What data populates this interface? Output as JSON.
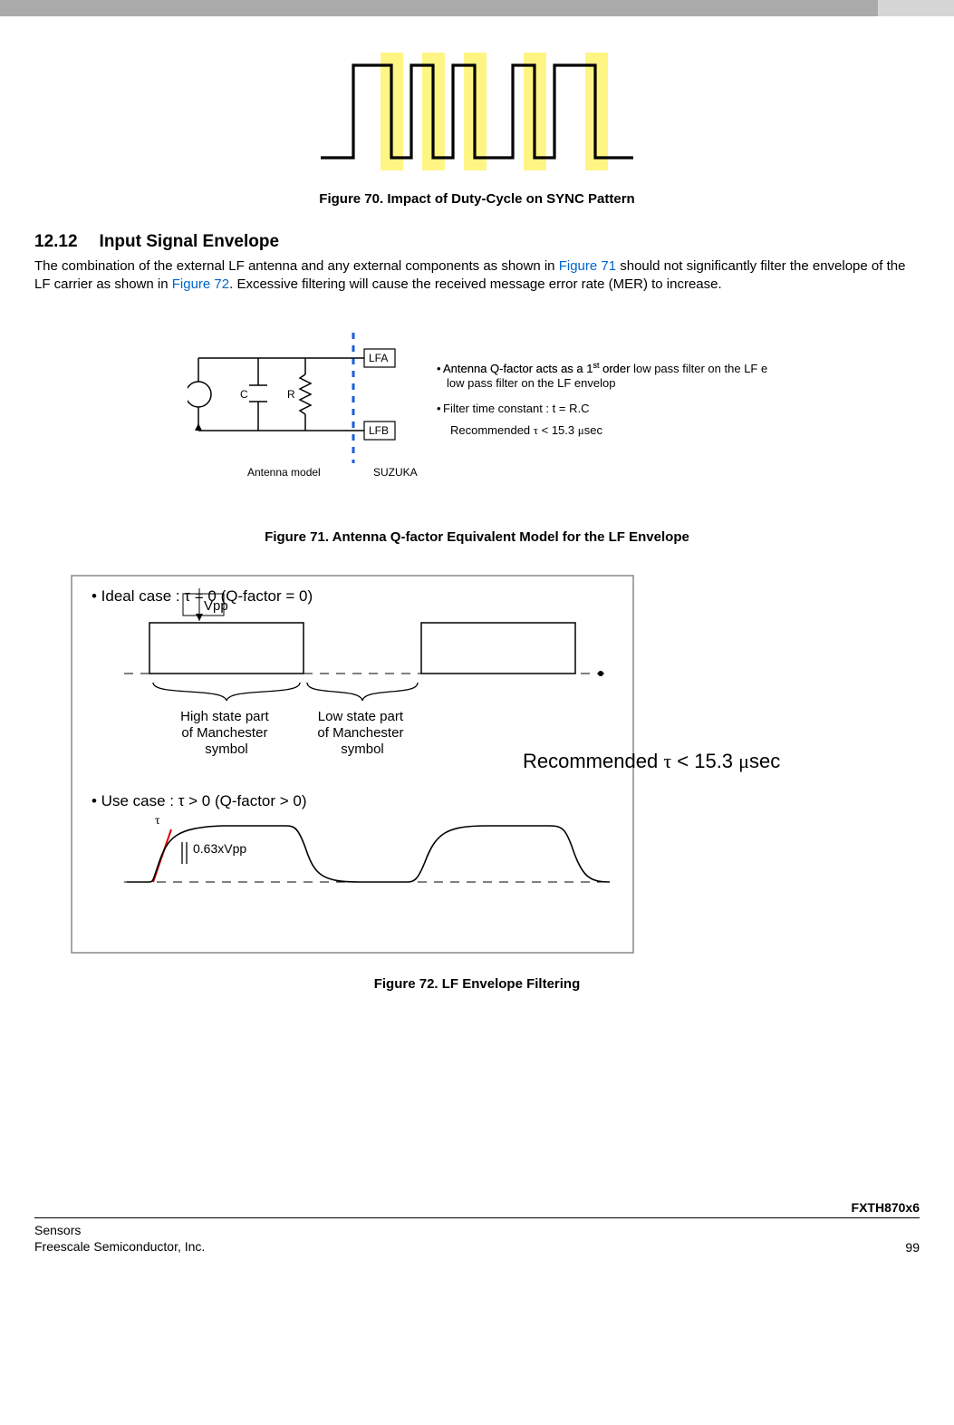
{
  "figure70": {
    "caption": "Figure 70. Impact of Duty-Cycle on SYNC Pattern"
  },
  "section": {
    "number": "12.12",
    "title": "Input Signal Envelope",
    "body_pre": "The combination of the external LF antenna and any external components as shown in ",
    "link1": "Figure 71",
    "body_mid1": " should not significantly filter the envelope of the LF carrier as shown in ",
    "link2": "Figure 72",
    "body_post": ". Excessive filtering will cause the received message error rate (MER) to increase."
  },
  "figure71": {
    "lfa": "LFA",
    "lfb": "LFB",
    "c_label": "C",
    "r_label": "R",
    "antenna_model": "Antenna model",
    "suzuka": "SUZUKA",
    "bullet1": "Antenna Q-factor acts as a 1",
    "bullet1_sup": "st",
    "bullet1_cont": " order low pass filter on the LF envelop",
    "bullet2": "Filter time constant : t = R.C",
    "rec_prefix": "Recommended ",
    "rec_tau": "τ",
    "rec_mid": " < 15.3 ",
    "rec_mu": "μ",
    "rec_suffix": "sec",
    "caption": "Figure 71. Antenna Q-factor Equivalent Model for the LF Envelope"
  },
  "figure72": {
    "ideal_case": "• Ideal case : τ = 0 (Q-factor = 0)",
    "vpp": "Vpp",
    "high_state_l1": "High state part",
    "high_state_l2": "of Manchester",
    "high_state_l3": "symbol",
    "low_state_l1": "Low state part",
    "low_state_l2": "of Manchester",
    "low_state_l3": "symbol",
    "rec_prefix": "Recommended ",
    "rec_tau": "τ",
    "rec_mid": " < 15.3 ",
    "rec_mu": "μ",
    "rec_suffix": "sec",
    "use_case": "• Use case : τ > 0 (Q-factor > 0)",
    "tau_label": "τ",
    "vpp063": "0.63xVpp",
    "caption": "Figure 72. LF Envelope Filtering"
  },
  "footer": {
    "part": "FXTH870x6",
    "sensors": "Sensors",
    "company": "Freescale Semiconductor, Inc.",
    "page": "99"
  }
}
